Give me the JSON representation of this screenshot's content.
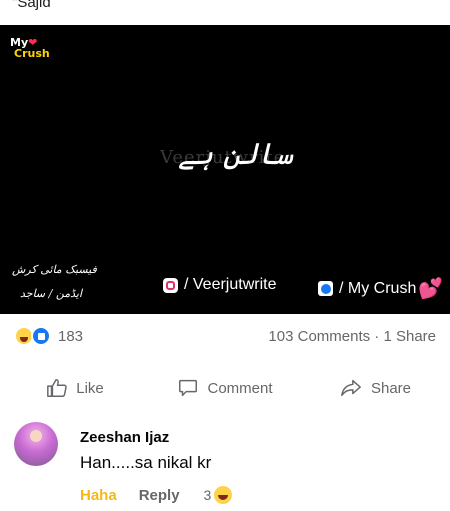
{
  "post": {
    "author_partial": "Sajid"
  },
  "video": {
    "logo_line1": "My",
    "logo_line2": "Crush",
    "watermark": "Veerjutwrite",
    "caption_urdu": "سالن ہے",
    "credit_line1": "فیسبک مائی کرش",
    "credit_line2": "ایڈمن / ساجد",
    "instagram_text": "/ Veerjutwrite",
    "facebook_text": "/ My Crush"
  },
  "reactions": {
    "count": "183",
    "stats": "103 Comments · 1 Share"
  },
  "actions": {
    "like": "Like",
    "comment": "Comment",
    "share": "Share"
  },
  "comment": {
    "author": "Zeeshan Ijaz",
    "text": "Han.....sa nikal kr",
    "haha_label": "Haha",
    "reply_label": "Reply",
    "reaction_count": "3"
  },
  "icons": [
    "instagram-icon",
    "facebook-icon",
    "heart-icon",
    "haha-icon",
    "like-icon",
    "comment-icon",
    "share-icon"
  ],
  "colors": {
    "facebook_blue": "#1877f2",
    "haha_yellow": "#f5b915",
    "secondary_text": "#65676b"
  }
}
